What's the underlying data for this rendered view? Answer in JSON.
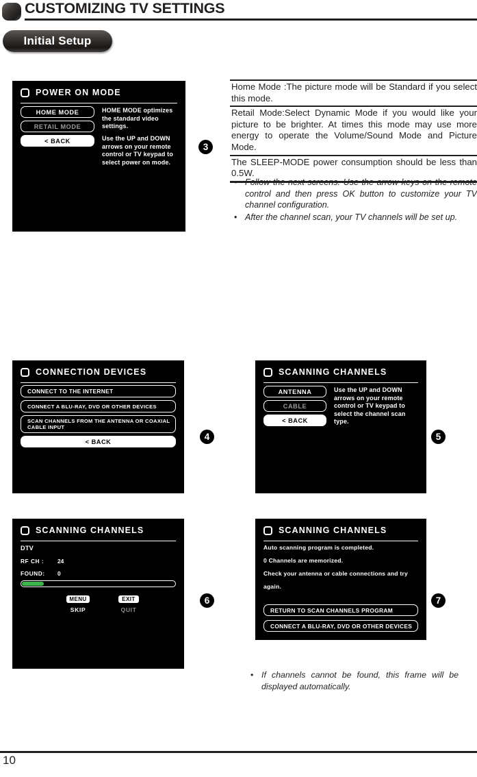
{
  "header": {
    "title": "CUSTOMIZING TV SETTINGS",
    "badge_icon": "rounded-square-icon"
  },
  "tab": {
    "label": "Initial Setup"
  },
  "panels": {
    "power_on_mode": {
      "title": "POWER ON MODE",
      "buttons": [
        {
          "label": "HOME MODE",
          "state": "selected"
        },
        {
          "label": "RETAIL MODE",
          "state": "dimmed"
        },
        {
          "label": "< BACK",
          "state": "highlighted"
        }
      ],
      "help_top": "HOME MODE optimizes the standard video settings.",
      "help_bottom": "Use the UP and DOWN arrows on your remote control or TV keypad to select power on mode."
    },
    "connection_devices": {
      "title": "CONNECTION DEVICES",
      "buttons": [
        {
          "label": "CONNECT TO THE INTERNET",
          "state": "normal"
        },
        {
          "label": "CONNECT A  BLU-RAY, DVD OR OTHER DEVICES",
          "state": "normal"
        },
        {
          "label": "SCAN CHANNELS FROM THE ANTENNA OR COAXIAL CABLE INPUT",
          "state": "normal"
        },
        {
          "label": "< BACK",
          "state": "highlighted"
        }
      ]
    },
    "scanning_channels_type": {
      "title": "SCANNING CHANNELS",
      "buttons": [
        {
          "label": "ANTENNA",
          "state": "selected"
        },
        {
          "label": "CABLE",
          "state": "dimmed"
        },
        {
          "label": "< BACK",
          "state": "highlighted"
        }
      ],
      "help": "Use the UP and DOWN arrows on your remote control or TV keypad to select the channel scan type."
    },
    "scanning_progress": {
      "title": "SCANNING CHANNELS",
      "source": "DTV",
      "rf_ch_label": "RF CH :",
      "rf_ch_value": "24",
      "found_label": "FOUND:",
      "found_value": "0",
      "progress_percent": 15,
      "progress_color": "#3cb54a",
      "keys": [
        {
          "chip": "MENU",
          "caption": "SKIP",
          "state": "active"
        },
        {
          "chip": "EXIT",
          "caption": "QUIT",
          "state": "dimmed"
        }
      ]
    },
    "scanning_complete": {
      "title": "SCANNING CHANNELS",
      "lines": [
        "Auto scanning program is completed.",
        "0    Channels are memorized.",
        "Check your antenna or cable connections and try",
        "again."
      ],
      "buttons": [
        {
          "label": "RETURN TO SCAN CHANNELS PROGRAM",
          "state": "normal"
        },
        {
          "label": "CONNECT A BLU-RAY, DVD OR OTHER DEVICES",
          "state": "normal"
        }
      ]
    }
  },
  "steps": [
    {
      "number": "3"
    },
    {
      "number": "4"
    },
    {
      "number": "5"
    },
    {
      "number": "6"
    },
    {
      "number": "7"
    }
  ],
  "info_rows": [
    "Home Mode :The picture mode will be Standard if you select this mode.",
    "Retail Mode:Select Dynamic Mode if you would like your picture to be brighter. At times this mode may use more energy to operate the Volume/Sound Mode and Picture Mode.",
    "The SLEEP-MODE power consumption should be less than 0.5W."
  ],
  "bullets_top": [
    "Follow the next screens. Use the arrow keys on the remote control and then press OK button to customize your TV channel configuration.",
    "After the channel scan, your TV channels will be set up."
  ],
  "bullets_bottom": [
    "If channels cannot be found, this frame will be displayed automatically."
  ],
  "footer": {
    "page_number": "10"
  }
}
